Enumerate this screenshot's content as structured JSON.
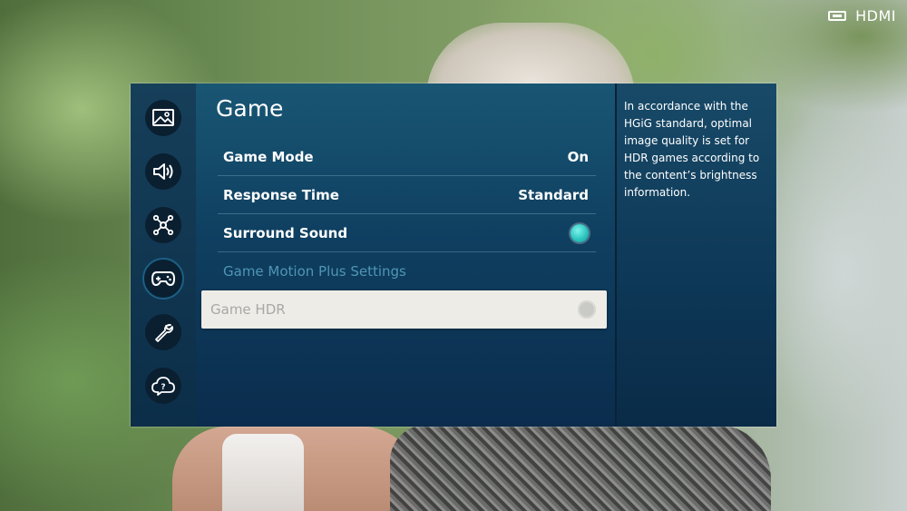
{
  "source": {
    "label": "HDMI",
    "icon": "hdmi-input-icon"
  },
  "sidebar": {
    "items": [
      {
        "icon": "picture-icon",
        "active": false
      },
      {
        "icon": "sound-icon",
        "active": false
      },
      {
        "icon": "connection-icon",
        "active": false
      },
      {
        "icon": "gamepad-icon",
        "active": true
      },
      {
        "icon": "wrench-icon",
        "active": false
      },
      {
        "icon": "support-icon",
        "active": false
      }
    ]
  },
  "main": {
    "title": "Game",
    "items": [
      {
        "label": "Game Mode",
        "value": "On",
        "type": "value",
        "state": "normal"
      },
      {
        "label": "Response Time",
        "value": "Standard",
        "type": "value",
        "state": "normal"
      },
      {
        "label": "Surround Sound",
        "type": "toggle",
        "on": true,
        "state": "normal"
      },
      {
        "label": "Game Motion Plus Settings",
        "type": "link",
        "state": "disabled"
      },
      {
        "label": "Game HDR",
        "type": "toggle",
        "on": false,
        "state": "focused"
      }
    ]
  },
  "info": {
    "text": "In accordance with the HGiG standard, optimal image quality is set for HDR games according to the content’s brightness information."
  },
  "colors": {
    "toggle_on": "#2dc6c0",
    "panel_blue": "#0f3f60",
    "disabled_text": "#4f95b5",
    "focus_bg": "#eeece6"
  }
}
